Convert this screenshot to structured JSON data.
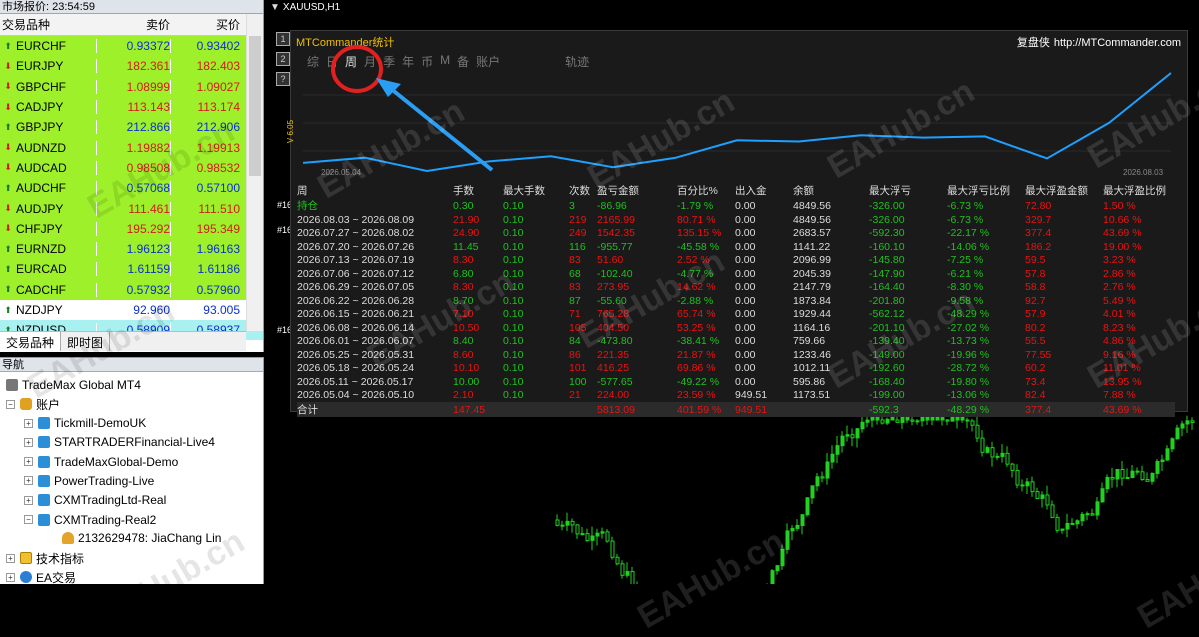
{
  "market_watch": {
    "title": "市场报价: 23:54:59",
    "col_symbol": "交易品种",
    "col_bid": "卖价",
    "col_ask": "买价",
    "rows": [
      {
        "symbol": "EURCHF",
        "bid": "0.93372",
        "ask": "0.93402",
        "dir": "up",
        "bg": "#9ef02a",
        "fg": "#0a2fd0"
      },
      {
        "symbol": "EURJPY",
        "bid": "182.361",
        "ask": "182.403",
        "dir": "down",
        "bg": "#9ef02a",
        "fg": "#d31b1b"
      },
      {
        "symbol": "GBPCHF",
        "bid": "1.08999",
        "ask": "1.09027",
        "dir": "down",
        "bg": "#9ef02a",
        "fg": "#d31b1b"
      },
      {
        "symbol": "CADJPY",
        "bid": "113.143",
        "ask": "113.174",
        "dir": "down",
        "bg": "#9ef02a",
        "fg": "#d31b1b"
      },
      {
        "symbol": "GBPJPY",
        "bid": "212.866",
        "ask": "212.906",
        "dir": "up",
        "bg": "#9ef02a",
        "fg": "#0a2fd0"
      },
      {
        "symbol": "AUDNZD",
        "bid": "1.19882",
        "ask": "1.19913",
        "dir": "down",
        "bg": "#9ef02a",
        "fg": "#d31b1b"
      },
      {
        "symbol": "AUDCAD",
        "bid": "0.98508",
        "ask": "0.98532",
        "dir": "down",
        "bg": "#9ef02a",
        "fg": "#d31b1b"
      },
      {
        "symbol": "AUDCHF",
        "bid": "0.57068",
        "ask": "0.57100",
        "dir": "up",
        "bg": "#9ef02a",
        "fg": "#0a2fd0"
      },
      {
        "symbol": "AUDJPY",
        "bid": "111.461",
        "ask": "111.510",
        "dir": "down",
        "bg": "#9ef02a",
        "fg": "#d31b1b"
      },
      {
        "symbol": "CHFJPY",
        "bid": "195.292",
        "ask": "195.349",
        "dir": "down",
        "bg": "#9ef02a",
        "fg": "#d31b1b"
      },
      {
        "symbol": "EURNZD",
        "bid": "1.96123",
        "ask": "1.96163",
        "dir": "up",
        "bg": "#9ef02a",
        "fg": "#0a2fd0"
      },
      {
        "symbol": "EURCAD",
        "bid": "1.61159",
        "ask": "1.61186",
        "dir": "up",
        "bg": "#9ef02a",
        "fg": "#0a2fd0"
      },
      {
        "symbol": "CADCHF",
        "bid": "0.57932",
        "ask": "0.57960",
        "dir": "up",
        "bg": "#9ef02a",
        "fg": "#0a2fd0"
      },
      {
        "symbol": "NZDJPY",
        "bid": "92.960",
        "ask": "93.005",
        "dir": "up",
        "bg": "#ffffff",
        "fg": "#0a2fd0"
      },
      {
        "symbol": "NZDUSD",
        "bid": "0.58909",
        "ask": "0.58937",
        "dir": "up",
        "bg": "#a9f0f0",
        "fg": "#0a2fd0"
      }
    ],
    "tabs": [
      "交易品种",
      "即时图"
    ]
  },
  "navigator": {
    "title": "导航",
    "root": "TradeMax Global MT4",
    "accounts_label": "账户",
    "servers": [
      "Tickmill-DemoUK",
      "STARTRADERFinancial-Live4",
      "TradeMaxGlobal-Demo",
      "PowerTrading-Live",
      "CXMTradingLtd-Real",
      "CXMTrading-Real2"
    ],
    "account": "2132629478: JiaChang Lin",
    "indicators": "技术指标",
    "ea": "EA交易"
  },
  "chart": {
    "title": "XAUUSD,H1",
    "side_buttons": [
      "1",
      "2",
      "?"
    ],
    "obj_labels": [
      "#16",
      "#16",
      "#16"
    ]
  },
  "panel": {
    "brand": "MTCommander统计",
    "site_name": "复盘侠",
    "site_url": "http://MTCommander.com",
    "menu": [
      "综",
      "日",
      "周",
      "月",
      "季",
      "年",
      "币",
      "M",
      "备",
      "账户",
      "轨迹"
    ],
    "active_menu": "周",
    "date_start": "2026.05.04",
    "date_end": "2026.08.03",
    "y_axis_label": "V 6.05",
    "headers": [
      "周",
      "手数",
      "最大手数",
      "次数",
      "盈亏金额",
      "百分比%",
      "出入金",
      "余额",
      "最大浮亏",
      "最大浮亏比例",
      "最大浮盈金额",
      "最大浮盈比例"
    ],
    "rows": [
      {
        "c": [
          "持仓",
          "0.30",
          "0.10",
          "3",
          "-86.96",
          "-1.79 %",
          "0.00",
          "4849.56",
          "-326.00",
          "-6.73 %",
          "72.80",
          "1.50 %"
        ],
        "k": "g"
      },
      {
        "c": [
          "2026.08.03 ~ 2026.08.09",
          "21.90",
          "0.10",
          "219",
          "2165.99",
          "80.71 %",
          "0.00",
          "4849.56",
          "-326.00",
          "-6.73 %",
          "329.7",
          "10.66 %"
        ],
        "k": "r"
      },
      {
        "c": [
          "2026.07.27 ~ 2026.08.02",
          "24.90",
          "0.10",
          "249",
          "1542.35",
          "135.15 %",
          "0.00",
          "2683.57",
          "-592.30",
          "-22.17 %",
          "377.4",
          "43.69 %"
        ],
        "k": "r"
      },
      {
        "c": [
          "2026.07.20 ~ 2026.07.26",
          "11.45",
          "0.10",
          "116",
          "-955.77",
          "-45.58 %",
          "0.00",
          "1141.22",
          "-160.10",
          "-14.06 %",
          "186.2",
          "19.00 %"
        ],
        "k": "g"
      },
      {
        "c": [
          "2026.07.13 ~ 2026.07.19",
          "8.30",
          "0.10",
          "83",
          "51.60",
          "2.52 %",
          "0.00",
          "2096.99",
          "-145.80",
          "-7.25 %",
          "59.5",
          "3.23 %"
        ],
        "k": "r"
      },
      {
        "c": [
          "2026.07.06 ~ 2026.07.12",
          "6.80",
          "0.10",
          "68",
          "-102.40",
          "-4.77 %",
          "0.00",
          "2045.39",
          "-147.90",
          "-6.21 %",
          "57.8",
          "2.86 %"
        ],
        "k": "g"
      },
      {
        "c": [
          "2026.06.29 ~ 2026.07.05",
          "8.30",
          "0.10",
          "83",
          "273.95",
          "14.62 %",
          "0.00",
          "2147.79",
          "-164.40",
          "-8.30 %",
          "58.8",
          "2.76 %"
        ],
        "k": "r"
      },
      {
        "c": [
          "2026.06.22 ~ 2026.06.28",
          "8.70",
          "0.10",
          "87",
          "-55.60",
          "-2.88 %",
          "0.00",
          "1873.84",
          "-201.80",
          "-9.58 %",
          "92.7",
          "5.49 %"
        ],
        "k": "g"
      },
      {
        "c": [
          "2026.06.15 ~ 2026.06.21",
          "7.10",
          "0.10",
          "71",
          "765.28",
          "65.74 %",
          "0.00",
          "1929.44",
          "-562.12",
          "-48.29 %",
          "57.9",
          "4.01 %"
        ],
        "k": "r"
      },
      {
        "c": [
          "2026.06.08 ~ 2026.06.14",
          "10.50",
          "0.10",
          "105",
          "404.50",
          "53.25 %",
          "0.00",
          "1164.16",
          "-201.10",
          "-27.02 %",
          "80.2",
          "8.23 %"
        ],
        "k": "r"
      },
      {
        "c": [
          "2026.06.01 ~ 2026.06.07",
          "8.40",
          "0.10",
          "84",
          "-473.80",
          "-38.41 %",
          "0.00",
          "759.66",
          "-139.40",
          "-13.73 %",
          "55.5",
          "4.86 %"
        ],
        "k": "g"
      },
      {
        "c": [
          "2026.05.25 ~ 2026.05.31",
          "8.60",
          "0.10",
          "86",
          "221.35",
          "21.87 %",
          "0.00",
          "1233.46",
          "-149.00",
          "-19.96 %",
          "77.55",
          "9.16 %"
        ],
        "k": "r"
      },
      {
        "c": [
          "2026.05.18 ~ 2026.05.24",
          "10.10",
          "0.10",
          "101",
          "416.25",
          "69.86 %",
          "0.00",
          "1012.11",
          "-192.60",
          "-28.72 %",
          "60.2",
          "11.01 %"
        ],
        "k": "r"
      },
      {
        "c": [
          "2026.05.11 ~ 2026.05.17",
          "10.00",
          "0.10",
          "100",
          "-577.65",
          "-49.22 %",
          "0.00",
          "595.86",
          "-168.40",
          "-19.80 %",
          "73.4",
          "13.95 %"
        ],
        "k": "g"
      },
      {
        "c": [
          "2026.05.04 ~ 2026.05.10",
          "2.10",
          "0.10",
          "21",
          "224.00",
          "23.59 %",
          "949.51",
          "1173.51",
          "-199.00",
          "-13.06 %",
          "82.4",
          "7.88 %"
        ],
        "k": "r"
      },
      {
        "c": [
          "合计",
          "147.45",
          "",
          "",
          "5813.09",
          "401.59 %",
          "949.51",
          "",
          "-592.3",
          "-48.29 %",
          "377.4",
          "43.69 %"
        ],
        "k": "t"
      }
    ],
    "equity_balance": [
      949.51,
      1173.51,
      595.86,
      1012.11,
      1233.46,
      759.66,
      1164.16,
      1929.44,
      1873.84,
      2147.79,
      2045.39,
      2096.99,
      1141.22,
      2683.57,
      4849.56
    ]
  },
  "watermark": "EAHub.cn",
  "colors": {
    "accent_yellow": "#f0c000",
    "equity_line": "#1ea0ff",
    "arrow": "#2a9df4",
    "circle": "#e22020",
    "profit": "#e11111",
    "loss": "#1ec21e"
  }
}
